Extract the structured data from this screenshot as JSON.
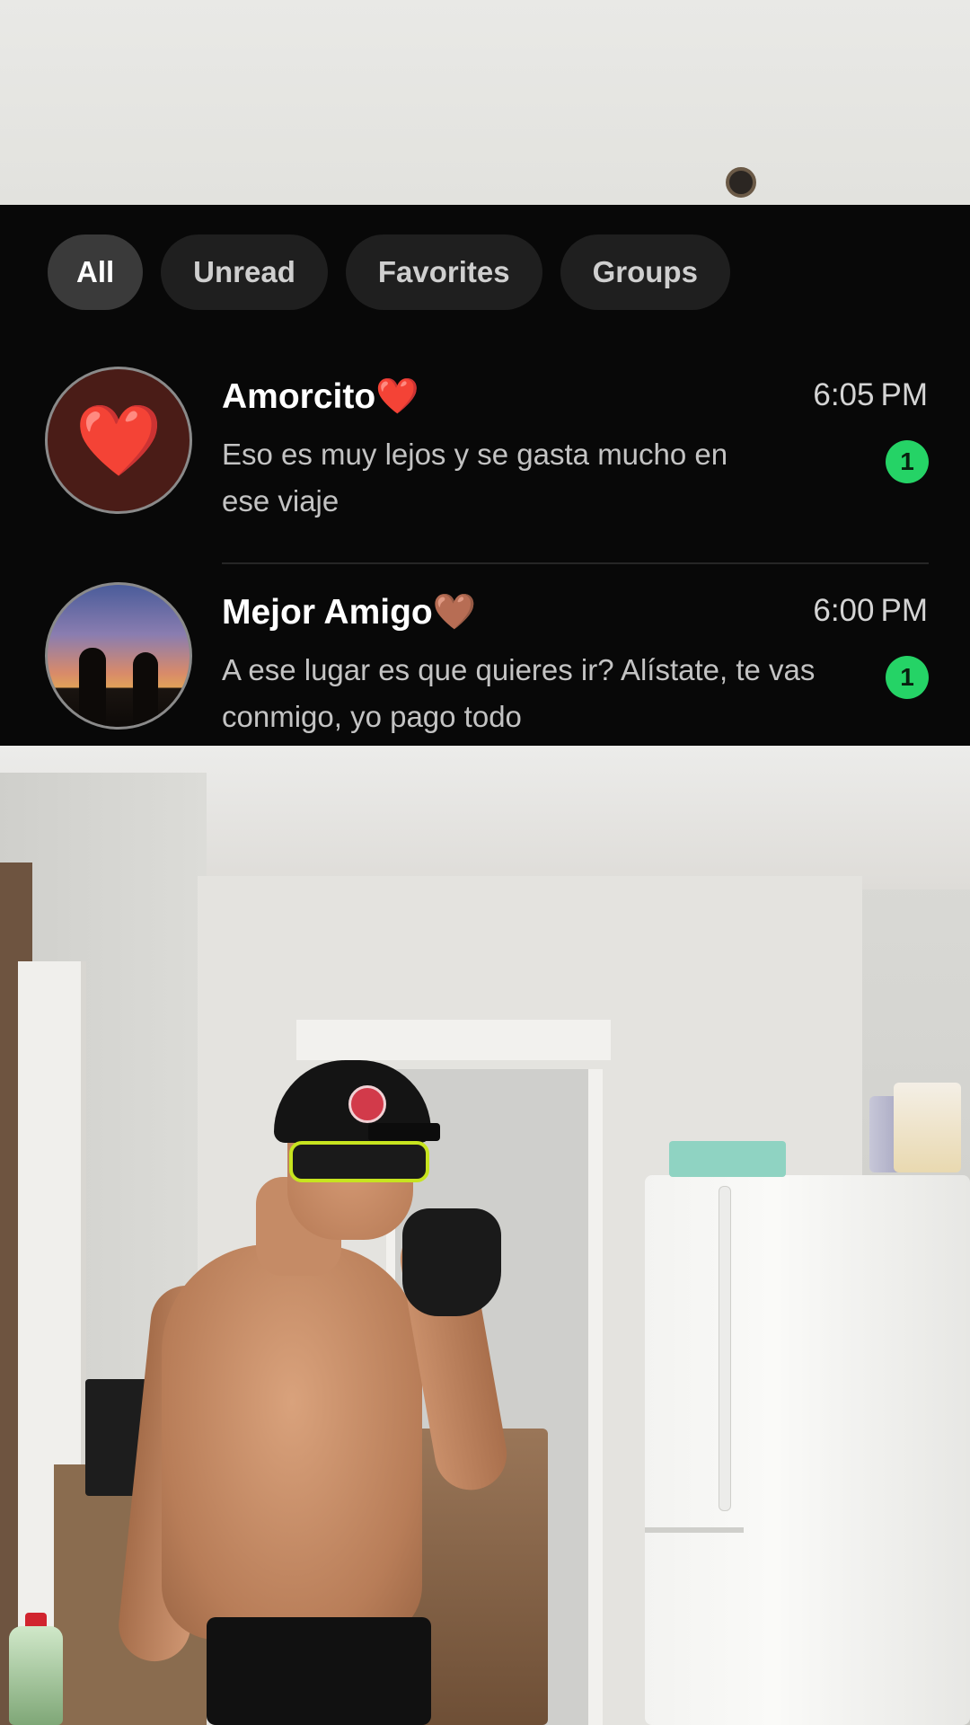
{
  "filters": {
    "all": "All",
    "unread": "Unread",
    "favorites": "Favorites",
    "groups": "Groups",
    "selected": "All"
  },
  "chats": [
    {
      "name": "Amorcito❤️",
      "time": "6:05 PM",
      "message": "Eso es muy lejos y se gasta mucho en ese viaje",
      "unread_count": "1",
      "avatar_icon": "❤️"
    },
    {
      "name": "Mejor Amigo🤎",
      "time": "6:00 PM",
      "message": "A ese lugar es que quieres ir? Alístate, te vas conmigo, yo pago todo",
      "unread_count": "1"
    }
  ],
  "colors": {
    "panel_background": "#080808",
    "chip_background": "#1f1f1f",
    "chip_active_background": "#3a3a3a",
    "unread_badge": "#25d366"
  }
}
